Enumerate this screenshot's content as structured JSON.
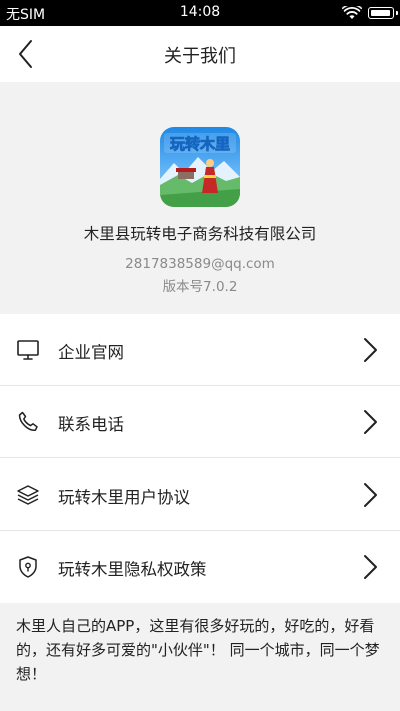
{
  "status_bar": {
    "carrier": "无SIM",
    "time": "14:08"
  },
  "nav": {
    "title": "关于我们"
  },
  "header": {
    "app_icon_text": "玩转木里",
    "company_name": "木里县玩转电子商务科技有限公司",
    "email": "2817838589@qq.com",
    "version": "版本号7.0.2"
  },
  "menu": {
    "items": [
      {
        "label": "企业官网",
        "icon": "monitor-icon"
      },
      {
        "label": "联系电话",
        "icon": "phone-icon"
      },
      {
        "label": "玩转木里用户协议",
        "icon": "layers-icon"
      },
      {
        "label": "玩转木里隐私权政策",
        "icon": "shield-icon"
      }
    ]
  },
  "intro": {
    "text": "木里人自己的APP，这里有很多好玩的，好吃的，好看的，还有好多可爱的\"小伙伴\"！ 同一个城市，同一个梦想！"
  },
  "colors": {
    "status_bar_bg": "#000000",
    "page_bg": "#f2f2f2",
    "card_bg": "#ffffff",
    "secondary_text": "#8a8a8a",
    "divider": "#e6e6e6"
  }
}
